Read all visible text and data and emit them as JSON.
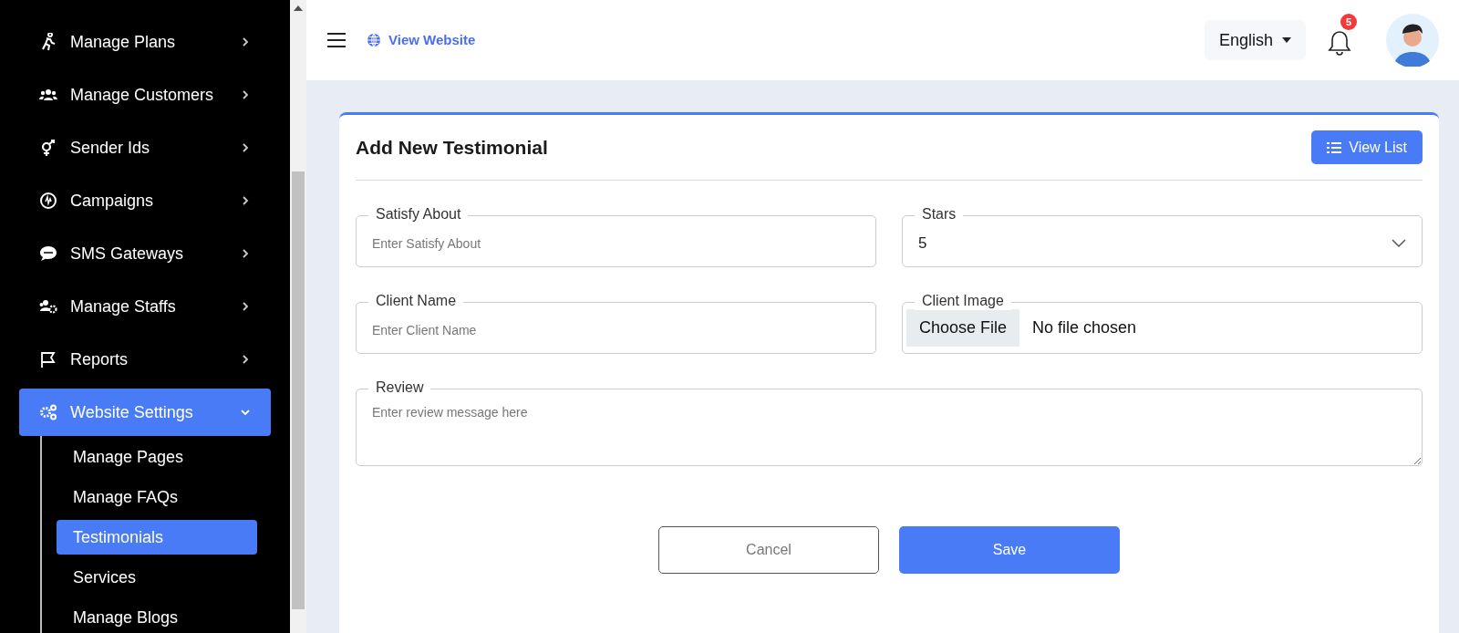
{
  "sidebar": {
    "items": [
      {
        "label": "Manage Plans",
        "selected": false,
        "expanded": false
      },
      {
        "label": "Manage Customers",
        "selected": false,
        "expanded": false
      },
      {
        "label": "Sender Ids",
        "selected": false,
        "expanded": false
      },
      {
        "label": "Campaigns",
        "selected": false,
        "expanded": false
      },
      {
        "label": "SMS Gateways",
        "selected": false,
        "expanded": false
      },
      {
        "label": "Manage Staffs",
        "selected": false,
        "expanded": false
      },
      {
        "label": "Reports",
        "selected": false,
        "expanded": false
      },
      {
        "label": "Website Settings",
        "selected": true,
        "expanded": true,
        "children": [
          {
            "label": "Manage Pages",
            "selected": false
          },
          {
            "label": "Manage FAQs",
            "selected": false
          },
          {
            "label": "Testimonials",
            "selected": true
          },
          {
            "label": "Services",
            "selected": false
          },
          {
            "label": "Manage Blogs",
            "selected": false
          }
        ]
      }
    ]
  },
  "header": {
    "view_website": "View Website",
    "language": "English",
    "notification_count": "5"
  },
  "form": {
    "title": "Add New Testimonial",
    "view_list_button": "View List",
    "fields": [
      {
        "kind": "text",
        "label": "Satisfy About",
        "placeholder": "Enter Satisfy About"
      },
      {
        "kind": "select",
        "label": "Stars",
        "value": "5"
      },
      {
        "kind": "text",
        "label": "Client Name",
        "placeholder": "Enter Client Name"
      },
      {
        "kind": "file",
        "label": "Client Image",
        "button": "Choose File",
        "status": "No file chosen"
      },
      {
        "kind": "textarea",
        "label": "Review",
        "placeholder": "Enter review message here"
      }
    ],
    "cancel_button": "Cancel",
    "save_button": "Save"
  }
}
